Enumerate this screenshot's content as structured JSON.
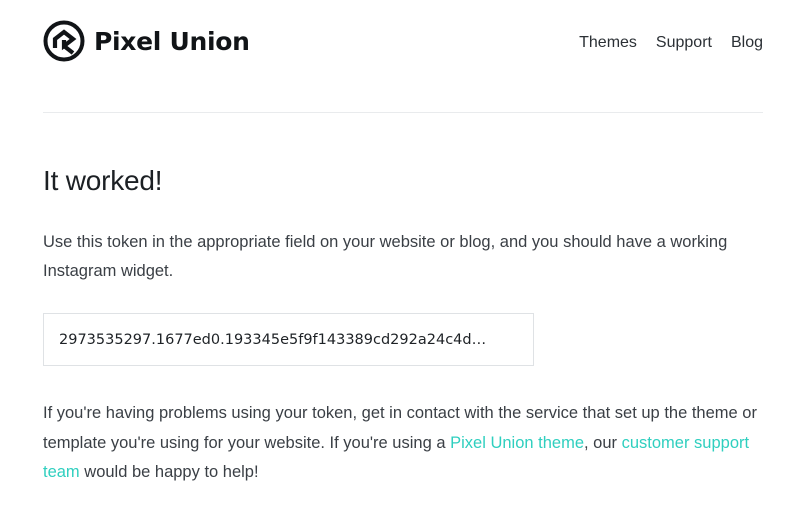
{
  "brand": {
    "name": "Pixel Union",
    "logo_icon": "pixel-union-logo-icon"
  },
  "nav": {
    "items": [
      {
        "label": "Themes"
      },
      {
        "label": "Support"
      },
      {
        "label": "Blog"
      }
    ]
  },
  "main": {
    "title": "It worked!",
    "intro": "Use this token in the appropriate field on your website or blog, and you should have a working Instagram widget.",
    "token": "2973535297.1677ed0.193345e5f9f143389cd292a24c4d…",
    "help": {
      "text_1": "If you're having problems using your token, get in contact with the service that set up the theme or template you're using for your website. If you're using a ",
      "link_1": "Pixel Union theme",
      "text_2": ", our ",
      "link_2": "customer support team",
      "text_3": " would be happy to help!"
    }
  },
  "colors": {
    "accent": "#2fcfbf",
    "text": "#3a3f45",
    "heading": "#1c2024",
    "divider": "#e9ebed"
  }
}
